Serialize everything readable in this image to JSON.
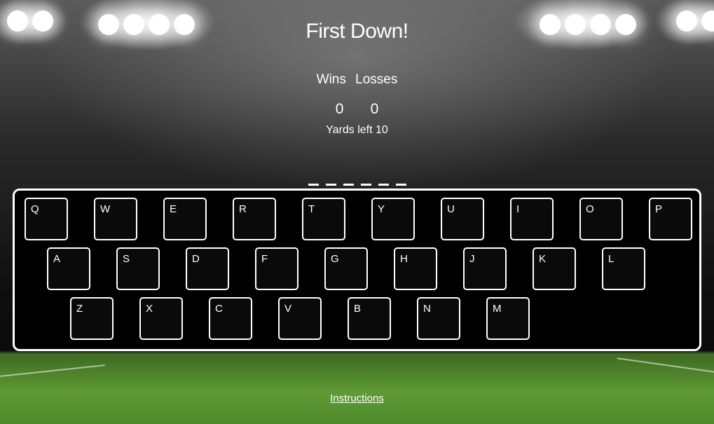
{
  "game": {
    "title": "First Down!",
    "wins_label": "Wins",
    "losses_label": "Losses",
    "wins_value": "0",
    "losses_value": "0",
    "yards_text": "Yards left 10",
    "word_length": 6,
    "instructions_link": "Instructions"
  },
  "keyboard": {
    "rows": [
      [
        "Q",
        "W",
        "E",
        "R",
        "T",
        "Y",
        "U",
        "I",
        "O",
        "P"
      ],
      [
        "A",
        "S",
        "D",
        "F",
        "G",
        "H",
        "J",
        "K",
        "L"
      ],
      [
        "Z",
        "X",
        "C",
        "V",
        "B",
        "N",
        "M"
      ]
    ]
  },
  "colors": {
    "keyboard_bg": "#000000",
    "key_border": "#ffffff",
    "grass": "#5f9a35"
  }
}
